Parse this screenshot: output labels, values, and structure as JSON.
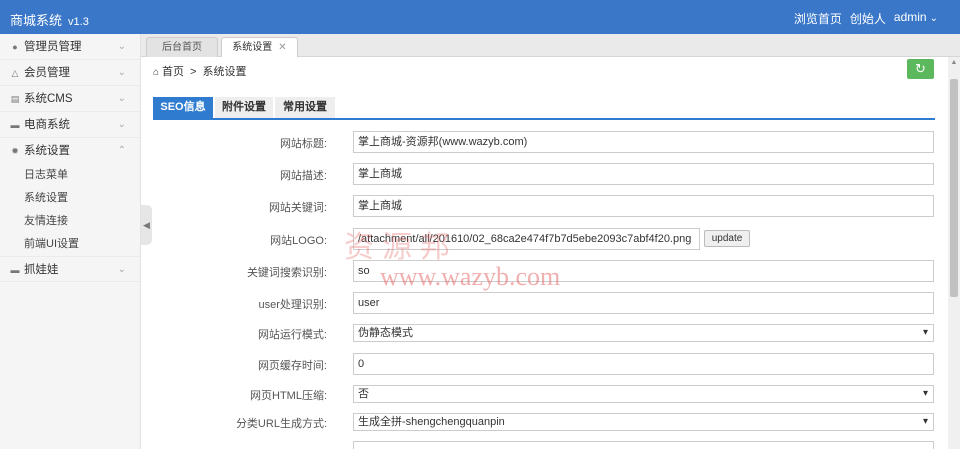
{
  "app": {
    "title": "商城系统",
    "version": "v1.3"
  },
  "topnav": {
    "browse": "浏览首页",
    "founder": "创始人",
    "user": "admin"
  },
  "sidebar": {
    "items": [
      {
        "label": "管理员管理",
        "icon": "user-icon"
      },
      {
        "label": "会员管理",
        "icon": "warning-icon"
      },
      {
        "label": "系统CMS",
        "icon": "list-icon"
      },
      {
        "label": "电商系统",
        "icon": "card-icon"
      },
      {
        "label": "系统设置",
        "icon": "gear-icon",
        "expanded": true
      }
    ],
    "subitems": [
      "日志菜单",
      "系统设置",
      "友情连接",
      "前端UI设置"
    ],
    "last": {
      "label": "抓娃娃",
      "icon": "card-icon"
    }
  },
  "tabs": [
    {
      "label": "后台首页"
    },
    {
      "label": "系统设置",
      "active": true
    }
  ],
  "breadcrumb": {
    "home": "首页",
    "current": "系统设置"
  },
  "subtabs": [
    "SEO信息",
    "附件设置",
    "常用设置"
  ],
  "form": {
    "site_title": {
      "label": "网站标题:",
      "value": "掌上商城-资源邦(www.wazyb.com)"
    },
    "site_desc": {
      "label": "网站描述:",
      "value": "掌上商城"
    },
    "site_keywords": {
      "label": "网站关键词:",
      "value": "掌上商城"
    },
    "site_logo": {
      "label": "网站LOGO:",
      "value": "/attachment/all/201610/02_68ca2e474f7b7d5ebe2093c7abf4f20.png",
      "button": "update"
    },
    "keyword_search": {
      "label": "关键词搜索识别:",
      "value": "so"
    },
    "user_handle": {
      "label": "user处理识别:",
      "value": "user"
    },
    "run_mode": {
      "label": "网站运行模式:",
      "value": "伪静态模式"
    },
    "cache_time": {
      "label": "网页缓存时间:",
      "value": "0"
    },
    "html_compress": {
      "label": "网页HTML压缩:",
      "value": "否"
    },
    "url_mode": {
      "label": "分类URL生成方式:",
      "value": "生成全拼-shengchengquanpin"
    }
  },
  "watermark": {
    "cn": "资源邦",
    "url": "www.wazyb.com"
  },
  "colors": {
    "primary": "#3a77c8",
    "accent": "#2e7bcf",
    "refresh": "#5cb85c"
  }
}
